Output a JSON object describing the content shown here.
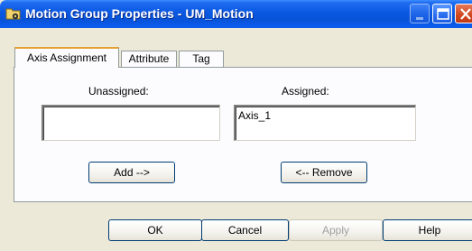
{
  "window": {
    "title": "Motion Group Properties - UM_Motion"
  },
  "tabs": [
    {
      "label": "Axis Assignment",
      "active": true
    },
    {
      "label": "Attribute",
      "active": false
    },
    {
      "label": "Tag",
      "active": false
    }
  ],
  "axis_assignment": {
    "unassigned_label": "Unassigned:",
    "assigned_label": "Assigned:",
    "unassigned_items": [],
    "assigned_items": [
      "Axis_1"
    ],
    "add_label": "Add -->",
    "remove_label": "<-- Remove"
  },
  "footer": {
    "ok_label": "OK",
    "cancel_label": "Cancel",
    "apply_label": "Apply",
    "apply_enabled": false,
    "help_label": "Help"
  },
  "colors": {
    "titlebar": "#0a58e2",
    "dialog_bg": "#ece9d8",
    "tab_highlight": "#e6a032"
  },
  "icons": [
    "motion-group-icon",
    "minimize-icon",
    "maximize-icon",
    "close-icon"
  ]
}
